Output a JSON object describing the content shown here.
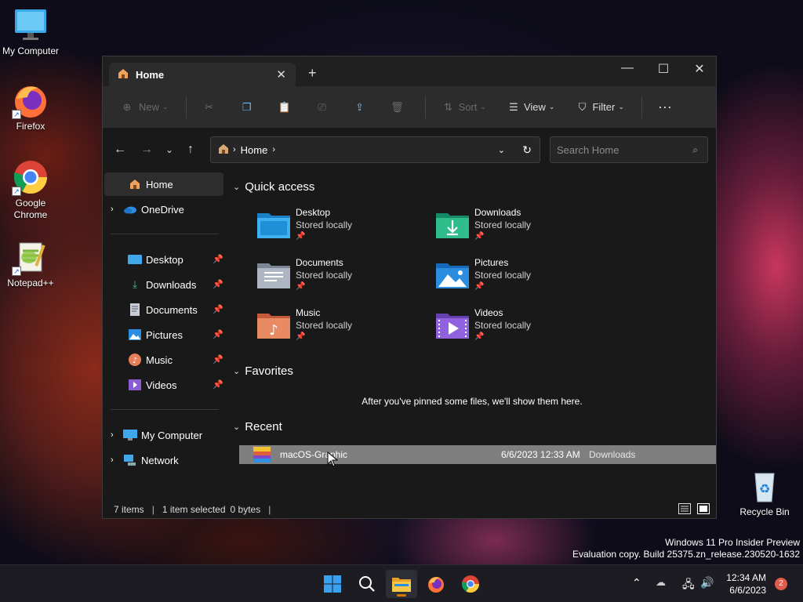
{
  "desktop": {
    "icons": [
      {
        "label": "My Computer"
      },
      {
        "label": "Firefox"
      },
      {
        "label": "Google Chrome"
      },
      {
        "label": "Notepad++"
      },
      {
        "label": "Recycle Bin"
      }
    ],
    "watermark_line1": "Windows 11 Pro Insider Preview",
    "watermark_line2": "Evaluation copy. Build 25375.zn_release.230520-1632"
  },
  "window": {
    "tab_title": "Home",
    "toolbar": {
      "new_label": "New",
      "sort_label": "Sort",
      "view_label": "View",
      "filter_label": "Filter"
    },
    "address": {
      "crumb": "Home",
      "search_placeholder": "Search Home"
    },
    "sidebar": {
      "home": "Home",
      "onedrive": "OneDrive",
      "pinned": [
        {
          "label": "Desktop"
        },
        {
          "label": "Downloads"
        },
        {
          "label": "Documents"
        },
        {
          "label": "Pictures"
        },
        {
          "label": "Music"
        },
        {
          "label": "Videos"
        }
      ],
      "my_computer": "My Computer",
      "network": "Network"
    },
    "quick_access": {
      "heading": "Quick access",
      "items": [
        {
          "name": "Desktop",
          "sub": "Stored locally",
          "icon": "desktop-folder-icon"
        },
        {
          "name": "Downloads",
          "sub": "Stored locally",
          "icon": "downloads-folder-icon"
        },
        {
          "name": "Documents",
          "sub": "Stored locally",
          "icon": "documents-folder-icon"
        },
        {
          "name": "Pictures",
          "sub": "Stored locally",
          "icon": "pictures-folder-icon"
        },
        {
          "name": "Music",
          "sub": "Stored locally",
          "icon": "music-folder-icon"
        },
        {
          "name": "Videos",
          "sub": "Stored locally",
          "icon": "videos-folder-icon"
        }
      ]
    },
    "favorites": {
      "heading": "Favorites",
      "empty_text": "After you've pinned some files, we'll show them here."
    },
    "recent": {
      "heading": "Recent",
      "items": [
        {
          "name": "macOS-Graphic",
          "date": "6/6/2023 12:33 AM",
          "location": "Downloads"
        }
      ]
    },
    "status": {
      "items_count": "7 items",
      "selection": "1 item selected",
      "size": "0 bytes"
    }
  },
  "taskbar": {
    "time": "12:34 AM",
    "date": "6/6/2023",
    "notification_count": "2"
  },
  "colors": {
    "accent": "#0078d4",
    "window_bg": "#191919",
    "toolbar_bg": "#2c2c2c",
    "selection": "#7f7f7f"
  }
}
